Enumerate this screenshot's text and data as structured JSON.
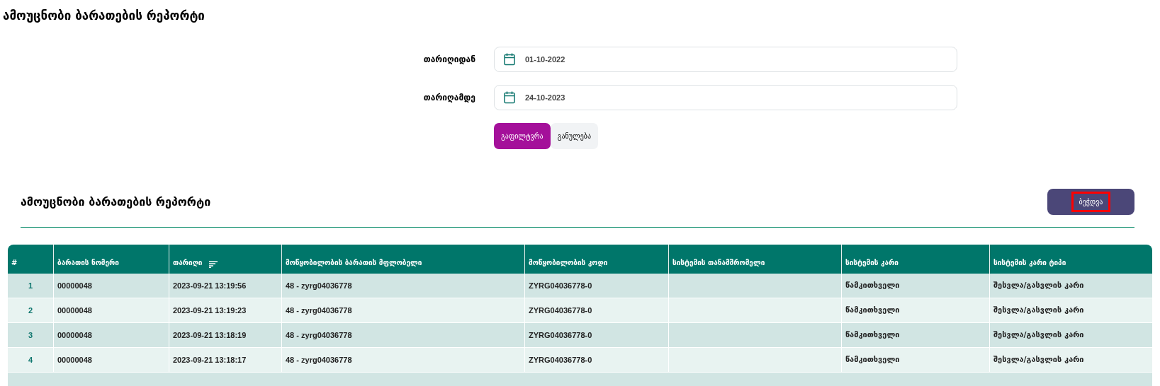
{
  "page_title": "ამოუცნობი ბარათების რეპორტი",
  "filter": {
    "fields": [
      {
        "label": "თარიღიდან",
        "value": "01-10-2022"
      },
      {
        "label": "თარიღამდე",
        "value": "24-10-2023"
      }
    ],
    "buttons": [
      {
        "label": "გაფილტვრა",
        "kind": "primary"
      },
      {
        "label": "განულება",
        "kind": "secondary"
      }
    ]
  },
  "report": {
    "title": "ამოუცნობი ბარათების რეპორტი",
    "print_button": {
      "label": "ბეჭდვა",
      "focused": true
    },
    "table": {
      "columns": [
        {
          "label": "#",
          "sortable": false
        },
        {
          "label": "ბარათის ნომერი",
          "sortable": false
        },
        {
          "label": "თარიღი",
          "sortable": true
        },
        {
          "label": "მოწყობილობის ბარათის მფლობელი",
          "sortable": false
        },
        {
          "label": "მოწყობილობის კოდი",
          "sortable": false
        },
        {
          "label": "სისტემის თანამშრომელი",
          "sortable": false
        },
        {
          "label": "სისტემის კარი",
          "sortable": false
        },
        {
          "label": "სისტემის კარი ტიპი",
          "sortable": false
        }
      ],
      "rows": [
        [
          "1",
          "00000048",
          "2023-09-21 13:19:56",
          "48 - zyrg04036778",
          "ZYRG04036778-0",
          "",
          "წამკითხველი",
          "შესვლა/გასვლის კარი"
        ],
        [
          "2",
          "00000048",
          "2023-09-21 13:19:23",
          "48 - zyrg04036778",
          "ZYRG04036778-0",
          "",
          "წამკითხველი",
          "შესვლა/გასვლის კარი"
        ],
        [
          "3",
          "00000048",
          "2023-09-21 13:18:19",
          "48 - zyrg04036778",
          "ZYRG04036778-0",
          "",
          "წამკითხველი",
          "შესვლა/გასვლის კარი"
        ],
        [
          "4",
          "00000048",
          "2023-09-21 13:18:17",
          "48 - zyrg04036778",
          "ZYRG04036778-0",
          "",
          "წამკითხველი",
          "შესვლა/გასვლის კარი"
        ]
      ]
    }
  }
}
